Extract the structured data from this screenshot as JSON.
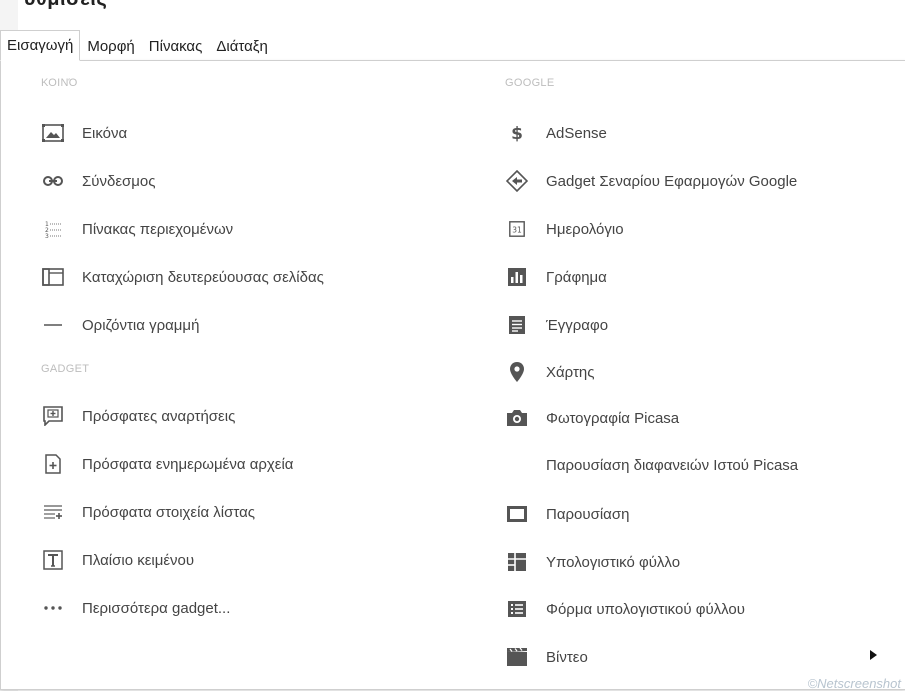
{
  "header": {
    "partial_title": "Ρυθμίσεις"
  },
  "menubar": {
    "tabs": [
      {
        "label": "Εισαγωγή",
        "active": true
      },
      {
        "label": "Μορφή",
        "active": false
      },
      {
        "label": "Πίνακας",
        "active": false
      },
      {
        "label": "Διάταξη",
        "active": false
      }
    ]
  },
  "menu": {
    "left": {
      "heading_common": "ΚΟΙΝΌ",
      "common_items": [
        {
          "label": "Εικόνα",
          "icon": "image-icon"
        },
        {
          "label": "Σύνδεσμος",
          "icon": "link-icon"
        },
        {
          "label": "Πίνακας περιεχομένων",
          "icon": "table-of-contents-icon"
        },
        {
          "label": "Καταχώριση δευτερεύουσας σελίδας",
          "icon": "subpage-listing-icon"
        },
        {
          "label": "Οριζόντια γραμμή",
          "icon": "horizontal-line-icon"
        }
      ],
      "heading_gadget": "GADGET",
      "gadget_items": [
        {
          "label": "Πρόσφατες αναρτήσεις",
          "icon": "recent-posts-icon"
        },
        {
          "label": "Πρόσφατα ενημερωμένα αρχεία",
          "icon": "recent-files-icon"
        },
        {
          "label": "Πρόσφατα στοιχεία λίστας",
          "icon": "recent-list-items-icon"
        },
        {
          "label": "Πλαίσιο κειμένου",
          "icon": "text-box-icon"
        },
        {
          "label": "Περισσότερα gadget...",
          "icon": "more-dots-icon"
        }
      ]
    },
    "right": {
      "heading_google": "GOOGLE",
      "google_items": [
        {
          "label": "AdSense",
          "icon": "dollar-icon"
        },
        {
          "label": "Gadget Σεναρίου Εφαρμογών Google",
          "icon": "apps-script-icon"
        },
        {
          "label": "Ημερολόγιο",
          "icon": "calendar-icon",
          "icon_text": "31"
        },
        {
          "label": "Γράφημα",
          "icon": "chart-icon"
        },
        {
          "label": "Έγγραφο",
          "icon": "document-icon"
        },
        {
          "label": "Χάρτης",
          "icon": "map-pin-icon"
        },
        {
          "label": "Φωτογραφία Picasa",
          "icon": "camera-icon"
        },
        {
          "label": "Παρουσίαση διαφανειών Ιστού Picasa",
          "icon": "none"
        },
        {
          "label": "Παρουσίαση",
          "icon": "presentation-icon"
        },
        {
          "label": "Υπολογιστικό φύλλο",
          "icon": "spreadsheet-icon"
        },
        {
          "label": "Φόρμα υπολογιστικού φύλλου",
          "icon": "form-icon"
        },
        {
          "label": "Βίντεο",
          "icon": "video-icon",
          "has_submenu": true
        }
      ]
    }
  },
  "watermark": "©Netscreenshot",
  "colors": {
    "heading": "#bdbdbd",
    "text": "#444444",
    "icon": "#555555",
    "border": "#cfcfcf"
  }
}
